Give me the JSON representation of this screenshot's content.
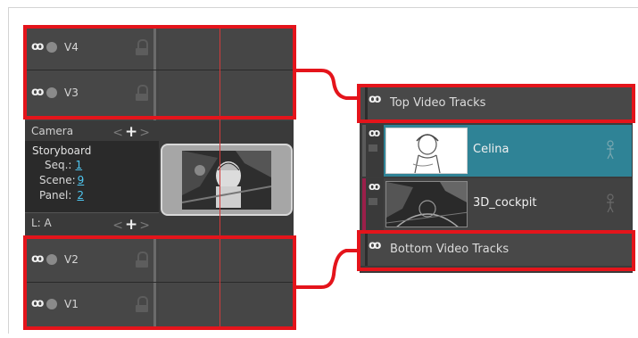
{
  "timeline": {
    "top_tracks": [
      {
        "label": "V4"
      },
      {
        "label": "V3"
      }
    ],
    "bottom_tracks": [
      {
        "label": "V2"
      },
      {
        "label": "V1"
      }
    ],
    "camera_label": "Camera",
    "nav_left": "<",
    "nav_plus": "+",
    "nav_right": ">",
    "storyboard": {
      "title": "Storyboard",
      "seq_label": "Seq.:",
      "seq_value": "1",
      "scene_label": "Scene:",
      "scene_value": "9",
      "panel_label": "Panel:",
      "panel_value": "2"
    },
    "layer_label": "L: A"
  },
  "layers_panel": {
    "top_group_title": "Top Video Tracks",
    "bottom_group_title": "Bottom Video Tracks",
    "layers": [
      {
        "name": "Celina",
        "row_color": "#2f8396"
      },
      {
        "name": "3D_cockpit",
        "row_color": "#424242"
      }
    ]
  },
  "colors": {
    "highlight": "#e4141b",
    "playhead": "#d23a3a",
    "selected_layer": "#2f8396",
    "link": "#4fc6f0"
  },
  "icons": {
    "eye": "eye-icon",
    "dot": "color-dot-icon",
    "lock": "lock-icon",
    "person": "person-icon"
  }
}
